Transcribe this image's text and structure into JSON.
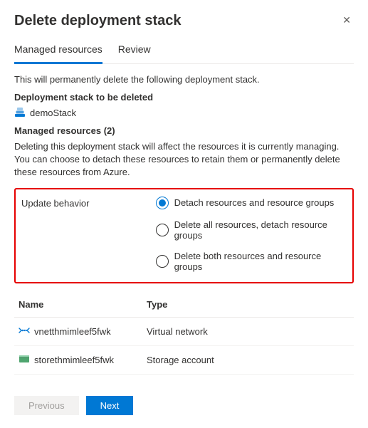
{
  "header": {
    "title": "Delete deployment stack"
  },
  "tabs": {
    "managed": "Managed resources",
    "review": "Review"
  },
  "intro": "This will permanently delete the following deployment stack.",
  "stack_head": "Deployment stack to be deleted",
  "stack_name": "demoStack",
  "managed_head": "Managed resources (2)",
  "managed_desc": "Deleting this deployment stack will affect the resources it is currently managing. You can choose to detach these resources to retain them or permanently delete these resources from Azure.",
  "behavior": {
    "label": "Update behavior",
    "options": {
      "o1": "Detach resources and resource groups",
      "o2": "Delete all resources, detach resource groups",
      "o3": "Delete both resources and resource groups"
    }
  },
  "table": {
    "head_name": "Name",
    "head_type": "Type",
    "rows": {
      "r1": {
        "name": "vnetthmimleef5fwk",
        "type": "Virtual network"
      },
      "r2": {
        "name": "storethmimleef5fwk",
        "type": "Storage account"
      }
    }
  },
  "footer": {
    "prev": "Previous",
    "next": "Next"
  }
}
